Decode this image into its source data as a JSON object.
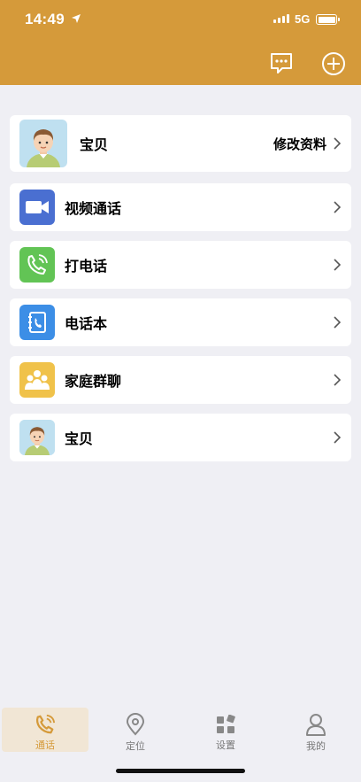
{
  "status_bar": {
    "time": "14:49",
    "network": "5G"
  },
  "header": {},
  "profile": {
    "name": "宝贝",
    "edit_label": "修改资料"
  },
  "menu": [
    {
      "label": "视频通话",
      "icon": "video-camera-icon",
      "color": "#4a6fd1"
    },
    {
      "label": "打电话",
      "icon": "phone-call-icon",
      "color": "#62c455"
    },
    {
      "label": "电话本",
      "icon": "phonebook-icon",
      "color": "#3c8ee6"
    },
    {
      "label": "家庭群聊",
      "icon": "family-group-icon",
      "color": "#f0c24a"
    },
    {
      "label": "宝贝",
      "icon": "avatar-icon",
      "color": "#bfe0f0"
    }
  ],
  "tabs": [
    {
      "label": "通话",
      "icon": "phone-icon",
      "active": true
    },
    {
      "label": "定位",
      "icon": "location-pin-icon",
      "active": false
    },
    {
      "label": "设置",
      "icon": "settings-grid-icon",
      "active": false
    },
    {
      "label": "我的",
      "icon": "user-icon",
      "active": false
    }
  ],
  "colors": {
    "accent": "#d59a3a",
    "background": "#efeff4",
    "card": "#ffffff"
  }
}
